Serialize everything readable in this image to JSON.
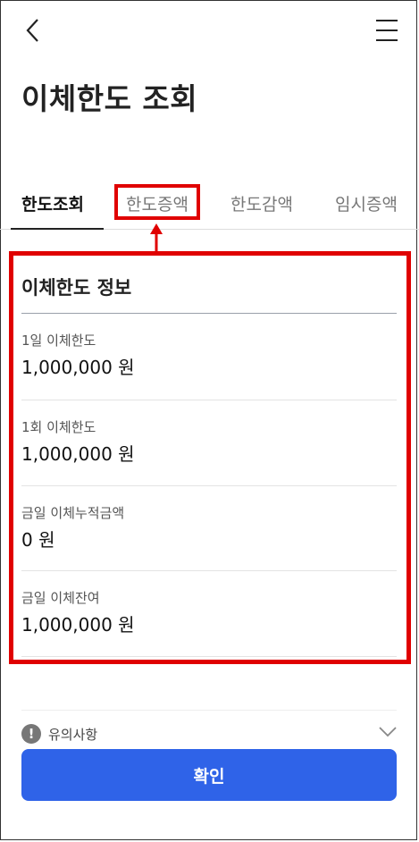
{
  "header": {
    "title": "이체한도 조회"
  },
  "tabs": [
    {
      "label": "한도조회"
    },
    {
      "label": "한도증액"
    },
    {
      "label": "한도감액"
    },
    {
      "label": "임시증액"
    }
  ],
  "info": {
    "title": "이체한도 정보",
    "items": [
      {
        "label": "1일 이체한도",
        "value": "1,000,000 원"
      },
      {
        "label": "1회 이체한도",
        "value": "1,000,000 원"
      },
      {
        "label": "금일 이체누적금액",
        "value": "0 원"
      },
      {
        "label": "금일 이체잔여",
        "value": "1,000,000 원"
      }
    ]
  },
  "notice": {
    "label": "유의사항",
    "icon": "exclamation-icon"
  },
  "confirm_label": "확인",
  "colors": {
    "accent": "#2f63e8",
    "highlight": "#e00000"
  }
}
